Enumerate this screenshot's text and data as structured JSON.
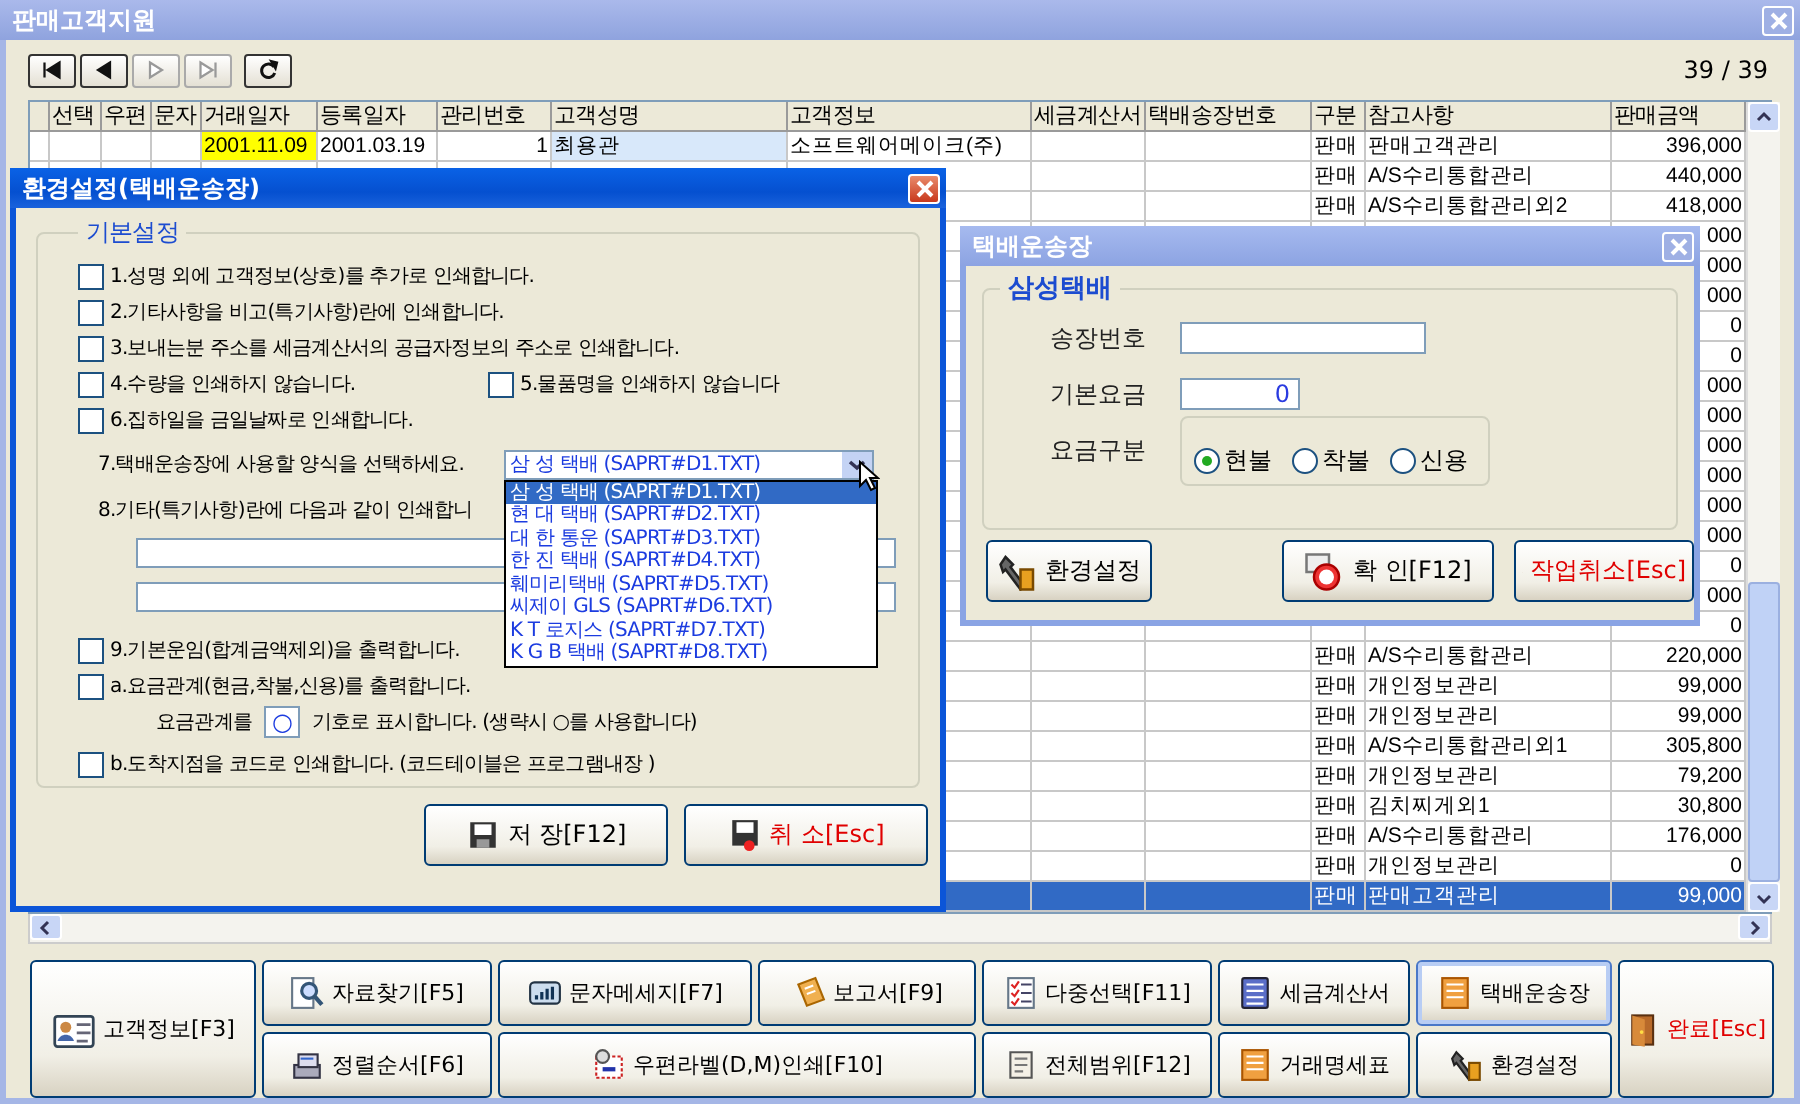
{
  "window": {
    "title": "판매고객지원"
  },
  "nav_buttons": [
    {
      "kind": "first",
      "disabled": false
    },
    {
      "kind": "prev",
      "disabled": false
    },
    {
      "kind": "next",
      "disabled": true
    },
    {
      "kind": "last",
      "disabled": true
    },
    {
      "kind": "refresh",
      "disabled": false
    }
  ],
  "record_counter": "39 / 39",
  "table": {
    "columns": [
      "선택",
      "우편",
      "문자",
      "거래일자",
      "등록일자",
      "관리번호",
      "고객성명",
      "고객정보",
      "세금계산서",
      "택배송장번호",
      "구분",
      "참고사항",
      "판매금액"
    ],
    "rows": [
      {
        "trade_date": "2001.11.09",
        "reg_date": "2001.03.19",
        "mgmt_no": "1",
        "customer_name": "최용관",
        "customer_info": "소프트웨어메이크(주)",
        "type": "판매",
        "note": "판매고객관리",
        "amount": "396,000",
        "selected": false,
        "focused": true
      },
      {
        "type": "판매",
        "note": "A/S수리통합관리",
        "amount": "440,000",
        "selected": false
      },
      {
        "type": "판매",
        "note": "A/S수리통합관리외2",
        "amount": "418,000",
        "selected": false
      },
      {
        "amount": "000",
        "selected": false
      },
      {
        "amount": "000",
        "selected": false
      },
      {
        "amount": "000",
        "selected": false
      },
      {
        "amount": "0",
        "selected": false
      },
      {
        "amount": "0",
        "selected": false
      },
      {
        "amount": "000",
        "selected": false
      },
      {
        "amount": "000",
        "selected": false
      },
      {
        "amount": "000",
        "selected": false
      },
      {
        "amount": "000",
        "selected": false
      },
      {
        "amount": "000",
        "selected": false
      },
      {
        "amount": "000",
        "selected": false
      },
      {
        "amount": "0",
        "selected": false
      },
      {
        "amount": "000",
        "selected": false
      },
      {
        "amount": "0",
        "selected": false
      },
      {
        "type": "판매",
        "note": "A/S수리통합관리",
        "amount": "220,000",
        "selected": false
      },
      {
        "type": "판매",
        "note": "개인정보관리",
        "amount": "99,000",
        "selected": false
      },
      {
        "type": "판매",
        "note": "개인정보관리",
        "amount": "99,000",
        "selected": false
      },
      {
        "type": "판매",
        "note": "A/S수리통합관리외1",
        "amount": "305,800",
        "selected": false
      },
      {
        "type": "판매",
        "note": "개인정보관리",
        "amount": "79,200",
        "selected": false
      },
      {
        "type": "판매",
        "note": "김치찌게외1",
        "amount": "30,800",
        "selected": false
      },
      {
        "type": "판매",
        "note": "A/S수리통합관리",
        "amount": "176,000",
        "selected": false
      },
      {
        "type": "판매",
        "note": "개인정보관리",
        "amount": "0",
        "selected": false
      },
      {
        "type": "판매",
        "note": "판매고객관리",
        "amount": "99,000",
        "selected": true
      }
    ]
  },
  "settings_dialog": {
    "title": "환경설정(택배운송장)",
    "group": "기본설정",
    "lines": [
      {
        "kind": "checks",
        "items": [
          {
            "label": "1.성명 외에 고객정보(상호)를 추가로 인쇄합니다.",
            "checked": false
          }
        ]
      },
      {
        "kind": "checks",
        "items": [
          {
            "label": "2.기타사항을 비고(특기사항)란에 인쇄합니다.",
            "checked": false
          }
        ]
      },
      {
        "kind": "checks",
        "items": [
          {
            "label": "3.보내는분 주소를 세금계산서의 공급자정보의 주소로 인쇄합니다.",
            "checked": false
          }
        ]
      },
      {
        "kind": "checks",
        "items": [
          {
            "label": "4.수량을 인쇄하지 않습니다.",
            "checked": false
          },
          {
            "label": "5.물품명을 인쇄하지 않습니다",
            "checked": false
          }
        ]
      },
      {
        "kind": "checks",
        "items": [
          {
            "label": "6.집하일을 금일날짜로 인쇄합니다.",
            "checked": false
          }
        ]
      },
      {
        "kind": "select",
        "label": "7.택배운송장에 사용할 양식을 선택하세요.",
        "value": "삼 성 택배 (SAPRT#D1.TXT)",
        "options": [
          {
            "label": "삼 성 택배 (SAPRT#D1.TXT)",
            "selected": true
          },
          {
            "label": "현 대 택배 (SAPRT#D2.TXT)",
            "selected": false
          },
          {
            "label": "대 한 통운 (SAPRT#D3.TXT)",
            "selected": false
          },
          {
            "label": "한 진 택배 (SAPRT#D4.TXT)",
            "selected": false
          },
          {
            "label": "훼미리택배 (SAPRT#D5.TXT)",
            "selected": false
          },
          {
            "label": "씨제이 GLS (SAPRT#D6.TXT)",
            "selected": false
          },
          {
            "label": "K T 로지스 (SAPRT#D7.TXT)",
            "selected": false
          },
          {
            "label": "K G B 택배 (SAPRT#D8.TXT)",
            "selected": false
          }
        ]
      },
      {
        "kind": "text",
        "label": "8.기타(특기사항)란에 다음과 같이 인쇄합니",
        "inputs": [
          {
            "kind": "input"
          },
          {
            "kind": "input"
          }
        ]
      },
      {
        "kind": "checks",
        "items": [
          {
            "label": "9.기본운임(합계금액제외)을 출력합니다.",
            "checked": false
          }
        ]
      },
      {
        "kind": "checks",
        "items": [
          {
            "label": "a.요금관계(현금,착불,신용)를 출력합니다.",
            "checked": false
          }
        ]
      },
      {
        "kind": "symbol",
        "before": "요금관계를",
        "symbol": "○",
        "after": "기호로 표시합니다. (생략시 ○를 사용합니다)"
      },
      {
        "kind": "checks",
        "items": [
          {
            "label": "b.도착지점을 코드로 인쇄합니다. (코드테이블은 프로그램내장 )",
            "checked": false
          }
        ]
      }
    ],
    "buttons": [
      {
        "label": "저 장[F12]",
        "kind": "save"
      },
      {
        "label": "취 소[Esc]",
        "kind": "cancel"
      }
    ]
  },
  "waybill_dialog": {
    "title": "택배운송장",
    "group": "삼성택배",
    "fields": [
      {
        "label": "송장번호"
      },
      {
        "label": "기본요금",
        "value": "0"
      }
    ],
    "fare": {
      "label": "요금구분",
      "options": [
        {
          "label": "현불",
          "selected": true
        },
        {
          "label": "착불",
          "selected": false
        },
        {
          "label": "신용",
          "selected": false
        }
      ]
    },
    "buttons": [
      {
        "label": "환경설정",
        "kind": "settings"
      },
      {
        "label": "확 인[F12]",
        "kind": "confirm"
      },
      {
        "label": "작업취소[Esc]",
        "kind": "abort"
      }
    ]
  },
  "toolbar": [
    {
      "label": "고객정보[F3]",
      "kind": "customer",
      "active": false
    },
    {
      "label": "자료찾기[F5]",
      "kind": "search",
      "active": false
    },
    {
      "label": "문자메세지[F7]",
      "kind": "sms",
      "active": false
    },
    {
      "label": "보고서[F9]",
      "kind": "report",
      "active": false
    },
    {
      "label": "다중선택[F11]",
      "kind": "multi",
      "active": false
    },
    {
      "label": "세금계산서",
      "kind": "tax",
      "active": false
    },
    {
      "label": "택배운송장",
      "kind": "delivery",
      "active": true
    },
    {
      "label": "완료[Esc]",
      "kind": "exit",
      "active": false
    },
    {
      "label": "정렬순서[F6]",
      "kind": "sort",
      "active": false
    },
    {
      "label": "우편라벨(D,M)인쇄[F10]",
      "kind": "postal",
      "active": false
    },
    {
      "label": "전체범위[F12]",
      "kind": "range",
      "active": false
    },
    {
      "label": "거래명세표",
      "kind": "statement",
      "active": false
    },
    {
      "label": "환경설정",
      "kind": "settings",
      "active": false
    }
  ]
}
